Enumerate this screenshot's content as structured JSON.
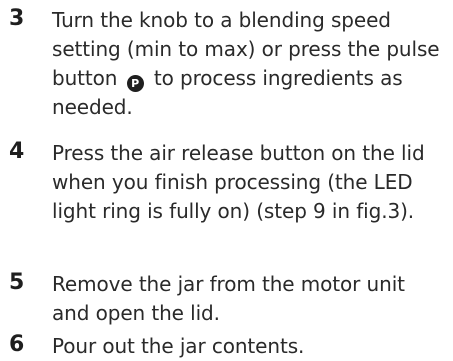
{
  "steps": [
    {
      "number": "3",
      "text_before_icon": "Turn the knob to a blending speed setting (min to max) or press the pulse button",
      "icon_name": "pulse-button-icon",
      "icon_glyph": "P",
      "text_after_icon": "to process ingredients as needed."
    },
    {
      "number": "4",
      "text": "Press the air release button on the lid when you finish processing (the LED light ring is fully on) (step 9 in fig.3)."
    },
    {
      "number": "5",
      "text": "Remove the jar from the motor unit and open the lid."
    },
    {
      "number": "6",
      "text": "Pour out the jar contents."
    }
  ]
}
